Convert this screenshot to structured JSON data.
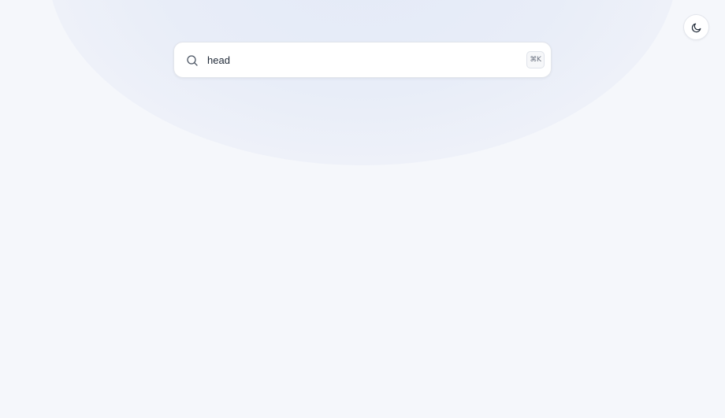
{
  "search": {
    "value": "head",
    "shortcut": "⌘K",
    "icon": "search-icon"
  },
  "theme_toggle": {
    "icon": "moon-icon"
  },
  "colors": {
    "background": "#f5f7fb",
    "glow": "#e6ebf7",
    "text": "#1f2937",
    "icon": "#4b5563"
  }
}
